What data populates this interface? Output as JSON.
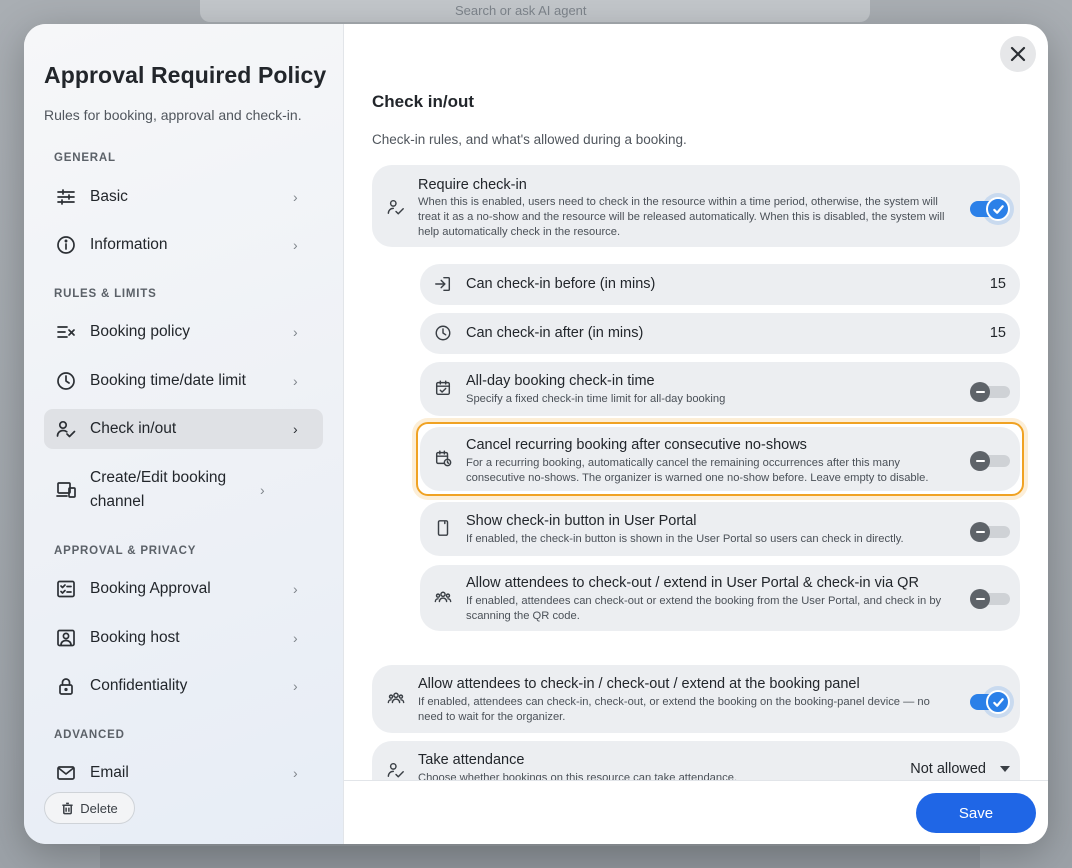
{
  "backdrop": {
    "search_placeholder": "Search or ask AI agent"
  },
  "sidebar": {
    "title": "Approval Required Policy",
    "subtitle": "Rules for booking, approval and check-in.",
    "sections": {
      "general": "GENERAL",
      "rules": "RULES & LIMITS",
      "approval": "APPROVAL & PRIVACY",
      "advanced": "ADVANCED"
    },
    "items": {
      "basic": "Basic",
      "information": "Information",
      "booking_policy": "Booking policy",
      "time_limit": "Booking time/date limit",
      "check_inout": "Check in/out",
      "channel": "Create/Edit booking channel",
      "approval": "Booking Approval",
      "host": "Booking host",
      "confidentiality": "Confidentiality",
      "email": "Email"
    },
    "delete_label": "Delete"
  },
  "main": {
    "title": "Check in/out",
    "subtitle": "Check-in rules, and what's allowed during a booking.",
    "require_checkin": {
      "title": "Require check-in",
      "desc": "When this is enabled, users need to check in the resource within a time period, otherwise, the system will treat it as a no-show and the resource will be released automatically. When this is disabled, the system will help automatically check in the resource.",
      "enabled": true
    },
    "before": {
      "title": "Can check-in before (in mins)",
      "value": "15"
    },
    "after": {
      "title": "Can check-in after (in mins)",
      "value": "15"
    },
    "allday": {
      "title": "All-day booking check-in time",
      "desc": "Specify a fixed check-in time limit for all-day booking",
      "enabled": false
    },
    "cancel_recurring": {
      "title": "Cancel recurring booking after consecutive no-shows",
      "desc": "For a recurring booking, automatically cancel the remaining occurrences after this many consecutive no-shows. The organizer is warned one no-show before. Leave empty to disable.",
      "enabled": false
    },
    "show_button": {
      "title": "Show check-in button in User Portal",
      "desc": "If enabled, the check-in button is shown in the User Portal so users can check in directly.",
      "enabled": false
    },
    "attendees_portal": {
      "title": "Allow attendees to check-out / extend in User Portal & check-in via QR",
      "desc": "If enabled, attendees can check-out or extend the booking from the User Portal, and check in by scanning the QR code.",
      "enabled": false
    },
    "attendees_panel": {
      "title": "Allow attendees to check-in / check-out / extend at the booking panel",
      "desc": "If enabled, attendees can check-in, check-out, or extend the booking on the booking-panel device — no need to wait for the organizer.",
      "enabled": true
    },
    "attendance": {
      "title": "Take attendance",
      "desc": "Choose whether bookings on this resource can take attendance.",
      "value": "Not allowed"
    }
  },
  "footer": {
    "save_label": "Save"
  },
  "colors": {
    "accent": "#1f66e6",
    "toggle_on": "#2b80e8",
    "highlight": "#f0a223"
  }
}
